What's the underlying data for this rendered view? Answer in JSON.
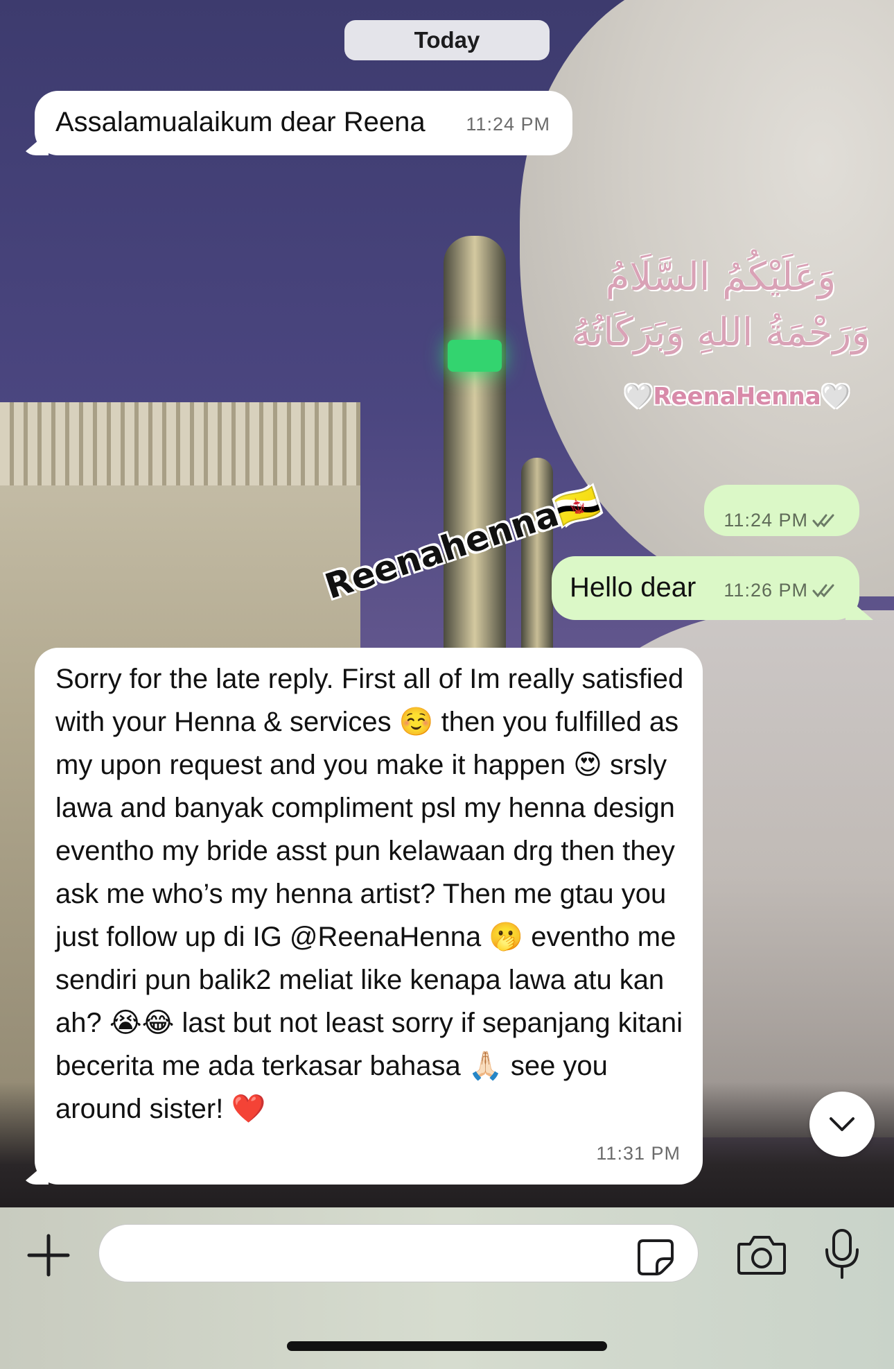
{
  "chat": {
    "date_label": "Today",
    "messages": [
      {
        "direction": "incoming",
        "text": "Assalamualaikum dear Reena",
        "time": "11:24 PM"
      },
      {
        "direction": "outgoing",
        "text": "",
        "time": "11:24 PM",
        "status": "read"
      },
      {
        "direction": "outgoing",
        "text": "Hello dear",
        "time": "11:26 PM",
        "status": "read"
      },
      {
        "direction": "incoming",
        "text": "Sorry for the late reply. First all of Im really satisfied with your Henna & services ☺️ then you fulfilled as my upon request and you make it happen 😍 srsly lawa and banyak compliment psl my henna design eventho my bride asst pun kelawaan drg then they ask me who’s my henna artist? Then me gtau you just follow up di IG @ReenaHenna 🫢 eventho me sendiri pun balik2 meliat like kenapa lawa atu kan ah? 😭😂 last but not least sorry if sepanjang kitani becerita me ada terkasar bahasa 🙏🏻 see you around sister! ❤️",
        "time": "11:31 PM"
      }
    ]
  },
  "wallpaper": {
    "arabic_text": "وَعَلَيْكُمُ السَّلَامُ وَرَحْمَةُ اللهِ وَبَرَكَاتُهُ",
    "brand_text": "🤍ReenaHenna🤍",
    "watermark_text": "Reenahenna🇧🇳"
  },
  "composer": {
    "placeholder": ""
  },
  "icons": {
    "plus": "plus-icon",
    "sticker": "sticker-icon",
    "camera": "camera-icon",
    "mic": "microphone-icon",
    "scroll_down": "chevron-down-icon",
    "read_receipt": "double-check-icon"
  },
  "colors": {
    "incoming_bubble": "#ffffff",
    "outgoing_bubble": "#dbf8c7",
    "date_pill": "#e4e4ea"
  }
}
